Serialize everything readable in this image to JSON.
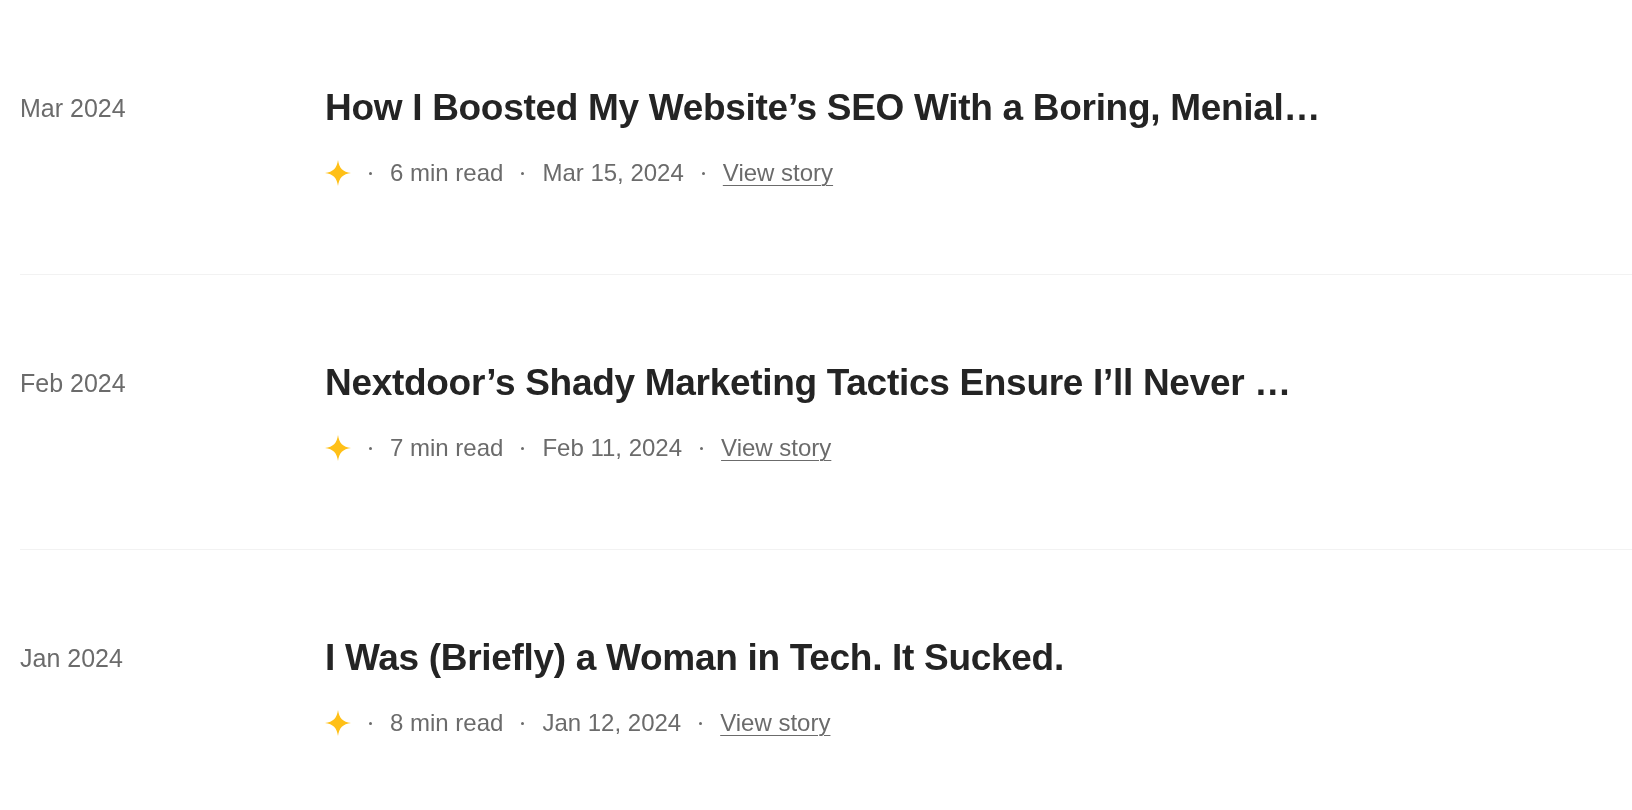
{
  "stories": [
    {
      "month": "Mar 2024",
      "title": "How I Boosted My Website’s SEO With a Boring, Menial…",
      "member_only": true,
      "read_time": "6 min read",
      "date": "Mar 15, 2024",
      "link": "View story"
    },
    {
      "month": "Feb 2024",
      "title": "Nextdoor’s Shady Marketing Tactics Ensure I’ll Never …",
      "member_only": true,
      "read_time": "7 min read",
      "date": "Feb 11, 2024",
      "link": "View story"
    },
    {
      "month": "Jan 2024",
      "title": "I Was (Briefly) a Woman in Tech. It Sucked.",
      "member_only": true,
      "read_time": "8 min read",
      "date": "Jan 12, 2024",
      "link": "View story"
    }
  ]
}
